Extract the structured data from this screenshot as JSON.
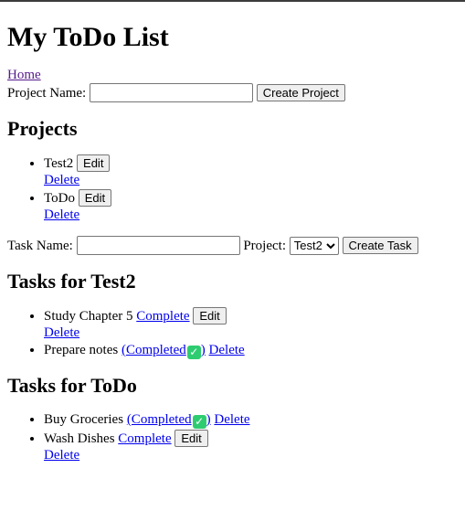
{
  "header": {
    "title": "My ToDo List"
  },
  "nav": {
    "home_label": "Home"
  },
  "project_form": {
    "label": "Project Name:",
    "value": "",
    "button_label": "Create Project"
  },
  "projects_section": {
    "heading": "Projects",
    "items": [
      {
        "name": "Test2",
        "edit_label": "Edit",
        "delete_label": "Delete"
      },
      {
        "name": "ToDo",
        "edit_label": "Edit",
        "delete_label": "Delete"
      }
    ]
  },
  "task_form": {
    "label": "Task Name:",
    "value": "",
    "project_label": "Project:",
    "project_selected": "Test2",
    "button_label": "Create Task"
  },
  "task_groups": [
    {
      "heading": "Tasks for Test2",
      "tasks": [
        {
          "name": "Study Chapter 5",
          "complete_label": "Complete",
          "edit_label": "Edit",
          "delete_label": "Delete"
        },
        {
          "name": "Prepare notes",
          "completed_label": "(Completed",
          "completed_icon": "check-mark-icon",
          "completed_close": ")",
          "delete_label": "Delete"
        }
      ]
    },
    {
      "heading": "Tasks for ToDo",
      "tasks": [
        {
          "name": "Buy Groceries",
          "completed_label": "(Completed",
          "completed_icon": "check-mark-icon",
          "completed_close": ")",
          "delete_label": "Delete"
        },
        {
          "name": "Wash Dishes",
          "complete_label": "Complete",
          "edit_label": "Edit",
          "delete_label": "Delete"
        }
      ]
    }
  ],
  "colors": {
    "link": "#0000ee",
    "visited_link": "#551a8b",
    "check_badge": "#2ecc71"
  }
}
